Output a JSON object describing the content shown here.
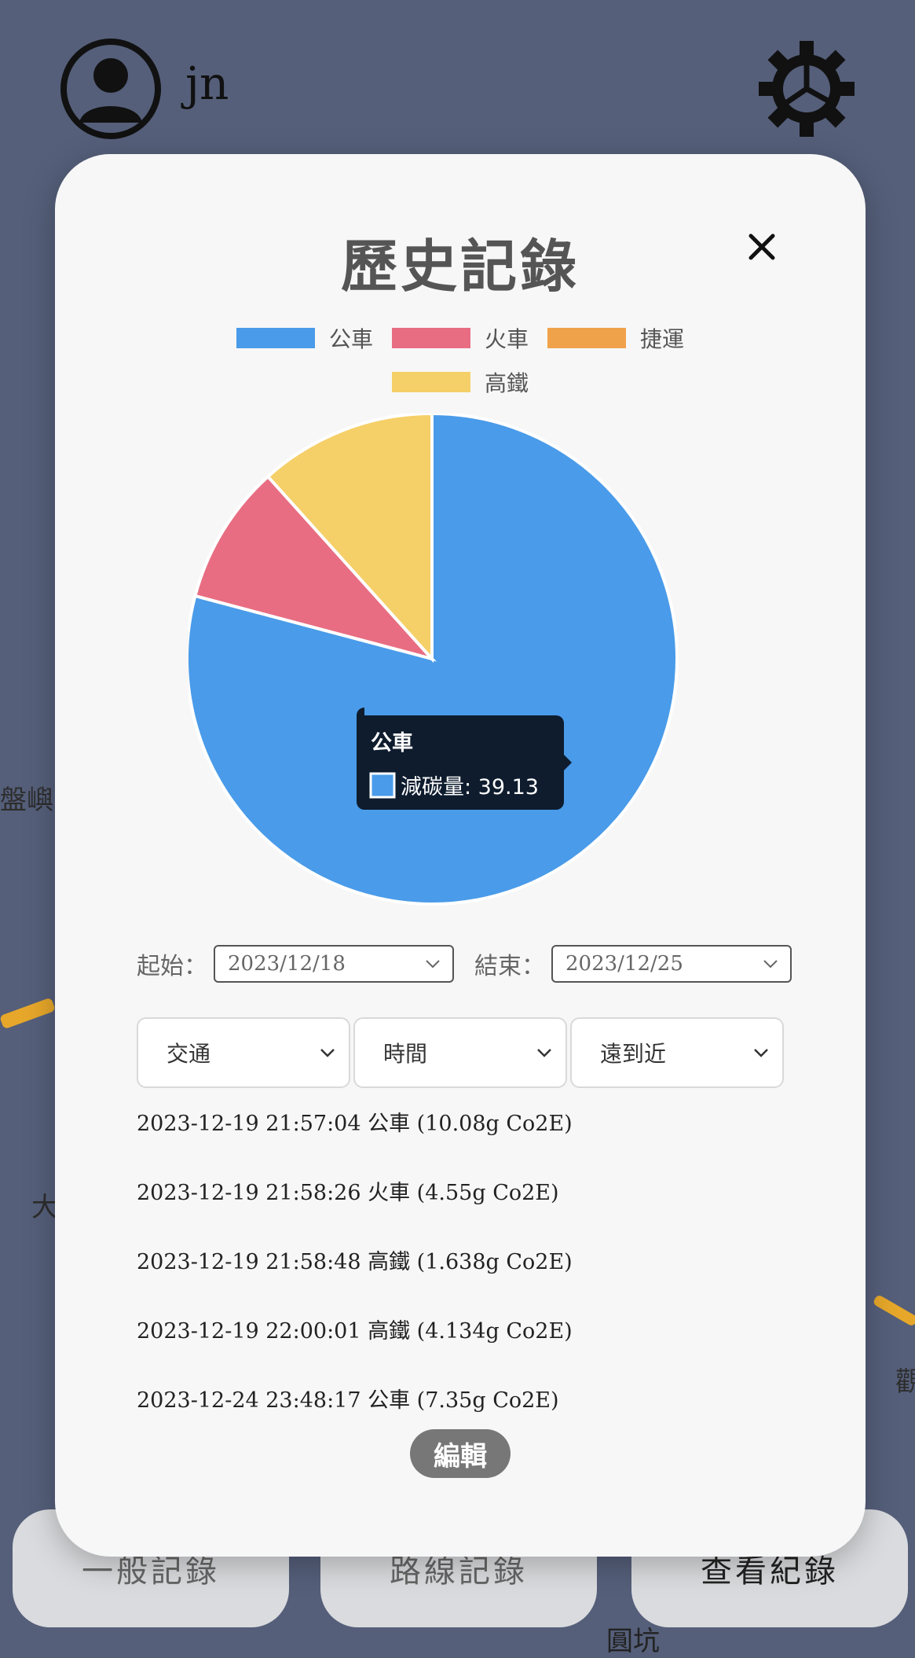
{
  "user": {
    "name": "jn"
  },
  "modal": {
    "title": "歷史記錄",
    "edit_label": "編輯"
  },
  "legend": [
    {
      "label": "公車",
      "color": "#4a9be9"
    },
    {
      "label": "火車",
      "color": "#e86d82"
    },
    {
      "label": "捷運",
      "color": "#f0a24b"
    },
    {
      "label": "高鐵",
      "color": "#f5cf68"
    }
  ],
  "chart_data": {
    "type": "pie",
    "categories": [
      "公車",
      "火車",
      "捷運",
      "高鐵"
    ],
    "values": [
      39.13,
      4.55,
      0,
      5.772
    ],
    "colors": [
      "#4a9be9",
      "#e86d82",
      "#f0a24b",
      "#f5cf68"
    ],
    "tooltip": {
      "title": "公車",
      "label": "減碳量: 39.13"
    }
  },
  "filters": {
    "start_label": "起始：",
    "start_value": "2023/12/18",
    "end_label": "結束：",
    "end_value": "2023/12/25",
    "transport": "交通",
    "sort_by": "時間",
    "order": "遠到近"
  },
  "records": [
    "2023-12-19 21:57:04 公車 (10.08g Co2E)",
    "2023-12-19 21:58:26 火車 (4.55g Co2E)",
    "2023-12-19 21:58:48 高鐵 (1.638g Co2E)",
    "2023-12-19 22:00:01 高鐵 (4.134g Co2E)",
    "2023-12-24 23:48:17 公車 (7.35g Co2E)"
  ],
  "tabs": [
    "一般記錄",
    "路線記錄",
    "查看紀錄"
  ],
  "map": {
    "labels": [
      "盤嶼",
      "大",
      "圓坑",
      "觀"
    ]
  }
}
